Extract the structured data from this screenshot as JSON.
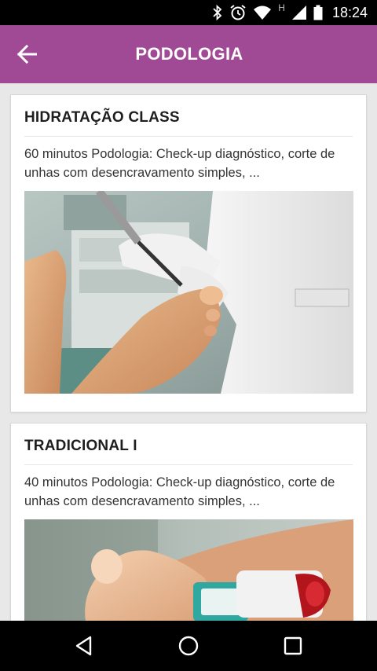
{
  "status_bar": {
    "time": "18:24",
    "network_type": "H"
  },
  "app_bar": {
    "title": "PODOLOGIA"
  },
  "cards": [
    {
      "title": "HIDRATAÇÃO CLASS",
      "description": "60 minutos Podologia: Check-up diagnóstico, corte de unhas com desencravamento simples, ..."
    },
    {
      "title": "TRADICIONAL I",
      "description": "40 minutos Podologia: Check-up diagnóstico, corte de unhas com desencravamento simples, ..."
    }
  ],
  "icons": {
    "back": "arrow-back-icon",
    "bluetooth": "bluetooth-icon",
    "alarm": "alarm-icon",
    "wifi": "wifi-icon",
    "signal": "cell-signal-icon",
    "battery": "battery-icon",
    "nav_back": "nav-back-triangle-icon",
    "nav_home": "nav-home-circle-icon",
    "nav_recent": "nav-recent-square-icon"
  },
  "colors": {
    "app_bar": "#a04a96",
    "status_bar": "#000000",
    "background": "#e8e8e8"
  }
}
